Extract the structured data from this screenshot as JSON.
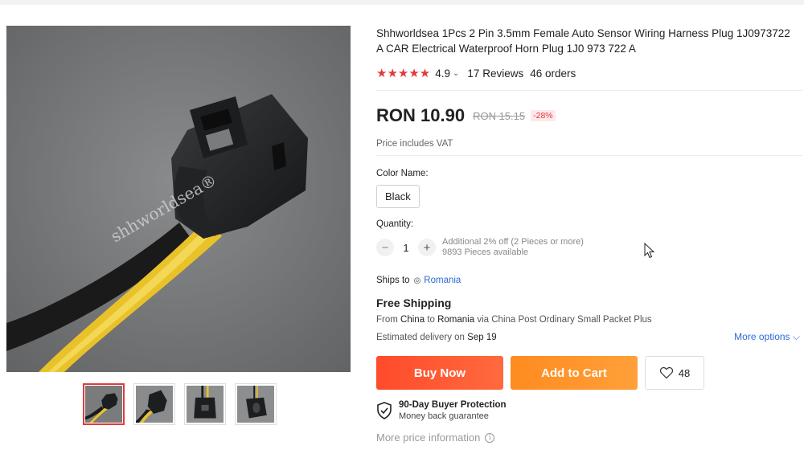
{
  "product": {
    "title": "Shhworldsea 1Pcs 2 Pin 3.5mm Female Auto Sensor Wiring Harness Plug 1J0973722 A CAR Electrical Waterproof Horn Plug 1J0 973 722 A",
    "watermark": "shhworldsea®",
    "stars": "★★★★★",
    "rating": "4.9",
    "reviews": "17 Reviews",
    "orders": "46 orders"
  },
  "price": {
    "current": "RON 10.90",
    "original": "RON 15.15",
    "discount": "-28%",
    "vat_note": "Price includes VAT"
  },
  "variant": {
    "label": "Color Name:",
    "selected": "Black"
  },
  "quantity": {
    "label": "Quantity:",
    "value": "1",
    "minus": "−",
    "plus": "+",
    "discount_note": "Additional 2% off (2 Pieces or more)",
    "available": "9893 Pieces available"
  },
  "shipping": {
    "ships_to_label": "Ships to",
    "country": "Romania",
    "free_label": "Free Shipping",
    "from_word": "From",
    "origin": "China",
    "to_word": "to",
    "destination": "Romania",
    "via": "via China Post Ordinary Small Packet Plus",
    "delivery_label": "Estimated delivery on",
    "delivery_date": "Sep 19",
    "more_options": "More options"
  },
  "actions": {
    "buy_now": "Buy Now",
    "add_to_cart": "Add to Cart",
    "wishlist_count": "48"
  },
  "protection": {
    "title": "90-Day Buyer Protection",
    "subtitle": "Money back guarantee"
  },
  "more_price_info": "More price information",
  "colors": {
    "accent_red": "#e4393c",
    "buy_now": "#ff4b2b",
    "add_to_cart": "#ff8b1f",
    "link_blue": "#2e6ad6"
  }
}
